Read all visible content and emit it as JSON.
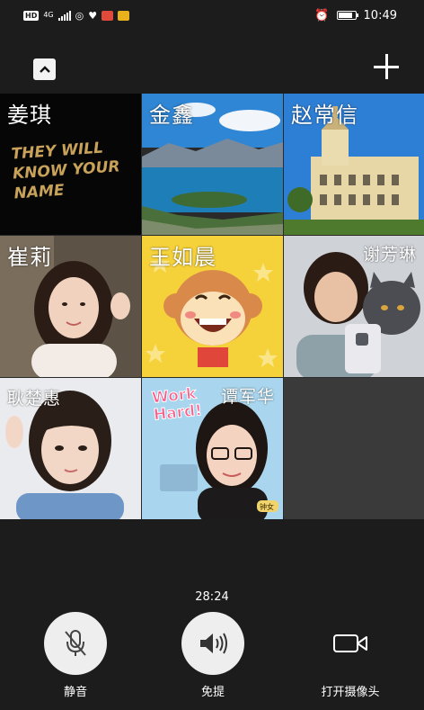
{
  "status_bar": {
    "network": "4G",
    "time": "10:49"
  },
  "top_bar": {
    "collapse_icon": "chevron-up-icon",
    "add_icon": "plus-icon"
  },
  "participants": [
    {
      "name": "姜琪",
      "tile_text": "THEY WILL KNOW YOUR NAME"
    },
    {
      "name": "金鑫"
    },
    {
      "name": "赵常信"
    },
    {
      "name": "崔莉"
    },
    {
      "name": "王如晨"
    },
    {
      "name": "谢芳琳"
    },
    {
      "name": "耿楚惠"
    },
    {
      "name": "谭军华",
      "tile_text": "Work Hard!",
      "badge": "钟女"
    }
  ],
  "call": {
    "duration": "28:24"
  },
  "controls": {
    "mute_label": "静音",
    "speaker_label": "免提",
    "camera_label": "打开摄像头"
  }
}
